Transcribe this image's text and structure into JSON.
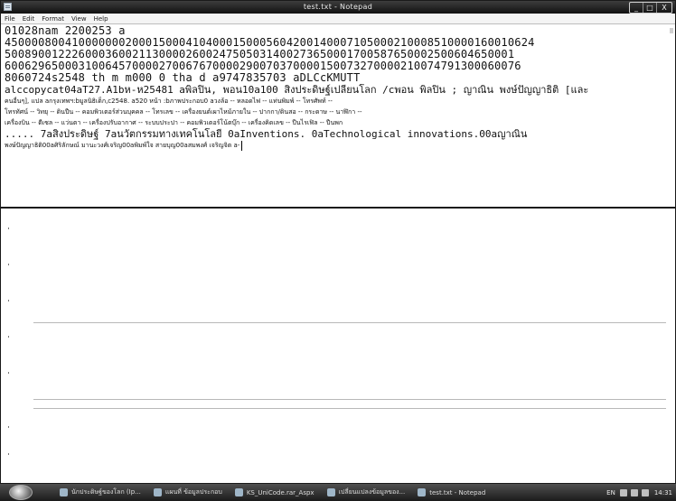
{
  "window": {
    "title": "test.txt - Notepad",
    "controls": [
      "_",
      "□",
      "X"
    ]
  },
  "menu": [
    "File",
    "Edit",
    "Format",
    "View",
    "Help"
  ],
  "document": {
    "lines": [
      "01028nam  2200253 a",
      "4500008004100000002000150004104000150005604200140007105000210008510000160010624",
      "5008900122260003600211300002600247505031400273650001700587650002500604650001",
      "60062965000310064570000270067670000290070370000150073270000210074791300060076",
      "8060724s2548      th m          m000 0 tha d  a9747835703  aDLCcKMUTT",
      "alccopycat04aT27.A1bห-ห25481 aพิลปิน, พอน10a100 สิ่งประดิษฐ์เปลี่ยนโลก /cพอน พิลปิน ;  ญาณิน พงษ์ปัญญาธิติ [และ",
      "คนอื่นๆ], แปล  aกรุงเทพฯ:bมูลนิธิเด็ก,c2548.   a520 หน้า :bภาพประกอบ0 aวงล้อ -- หลอดไฟ -- แท่นพิมพ์ -- โทรศัพท์ --",
      "โทรทัศน์ -- วิทยุ -- ดินปืน -- คอมพิวเตอร์ส่วนบุคคล -- โทรเลข -- เครื่องยนต์เผาไหม้ภายใน -- ปากกา/ดินสอ -- กระดาษ -- นาฬิกา --",
      "เครื่องบิน -- ดีเซล -- แว่นตา -- เครื่องปรับอากาศ -- ระบบประปา -- คอมพิวเตอร์โน้ตบุ๊ก -- เครื่องคิดเลข -- ปืนไรเฟิล -- ปืนพก",
      "..... 7aสิ่งประดิษฐ์ 7aนวัตกรรมทางเทคโนโลยี 0aInventions. 0aTechnological innovations.00aญาณิน",
      "พงษ์ปัญญาธิติ00aศิริลักษณ์ มานะวงศ์เจริญ00aพิมพ์ใจ สายบุญ00aสมพงศ์ เจริญจิต   a-"
    ]
  },
  "taskbar": {
    "items": [
      "นักประดิษฐ์ของโลก (Ip...",
      "แผนที่ ข้อมูลประกอบ",
      "KS_UniCode.rar_Aspx",
      "เปลี่ยนแปลงข้อมูลของ...",
      "test.txt - Notepad"
    ],
    "tray_lang": "EN",
    "clock": "14:31"
  }
}
